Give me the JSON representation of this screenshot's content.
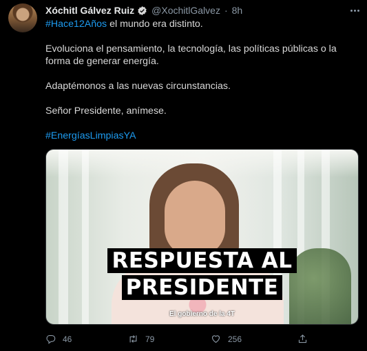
{
  "tweet": {
    "author_name": "Xóchitl Gálvez Ruiz",
    "handle": "@XochitlGalvez",
    "separator": "·",
    "time": "8h",
    "line1_hashtag": "#Hace12Años",
    "line1_text": " el mundo era distinto.",
    "para2": "Evoluciona el pensamiento, la tecnología, las políticas públicas o la forma de generar energía.",
    "para3": "Adaptémonos a las nuevas circunstancias.",
    "para4": "Señor Presidente, anímese.",
    "hashtag2": "#EnergíasLimpiasYA"
  },
  "media": {
    "caption_line1": "RESPUESTA AL",
    "caption_line2": "PRESIDENTE",
    "subcaption": "El gobierno de la 4T"
  },
  "actions": {
    "reply_count": "46",
    "retweet_count": "79",
    "like_count": "256"
  },
  "icons": {
    "verified": "verified-badge-icon",
    "more": "more-icon",
    "reply": "reply-icon",
    "retweet": "retweet-icon",
    "like": "like-icon",
    "share": "share-icon"
  },
  "colors": {
    "accent": "#1d9bf0",
    "background": "#000000",
    "muted": "#8b98a5"
  }
}
